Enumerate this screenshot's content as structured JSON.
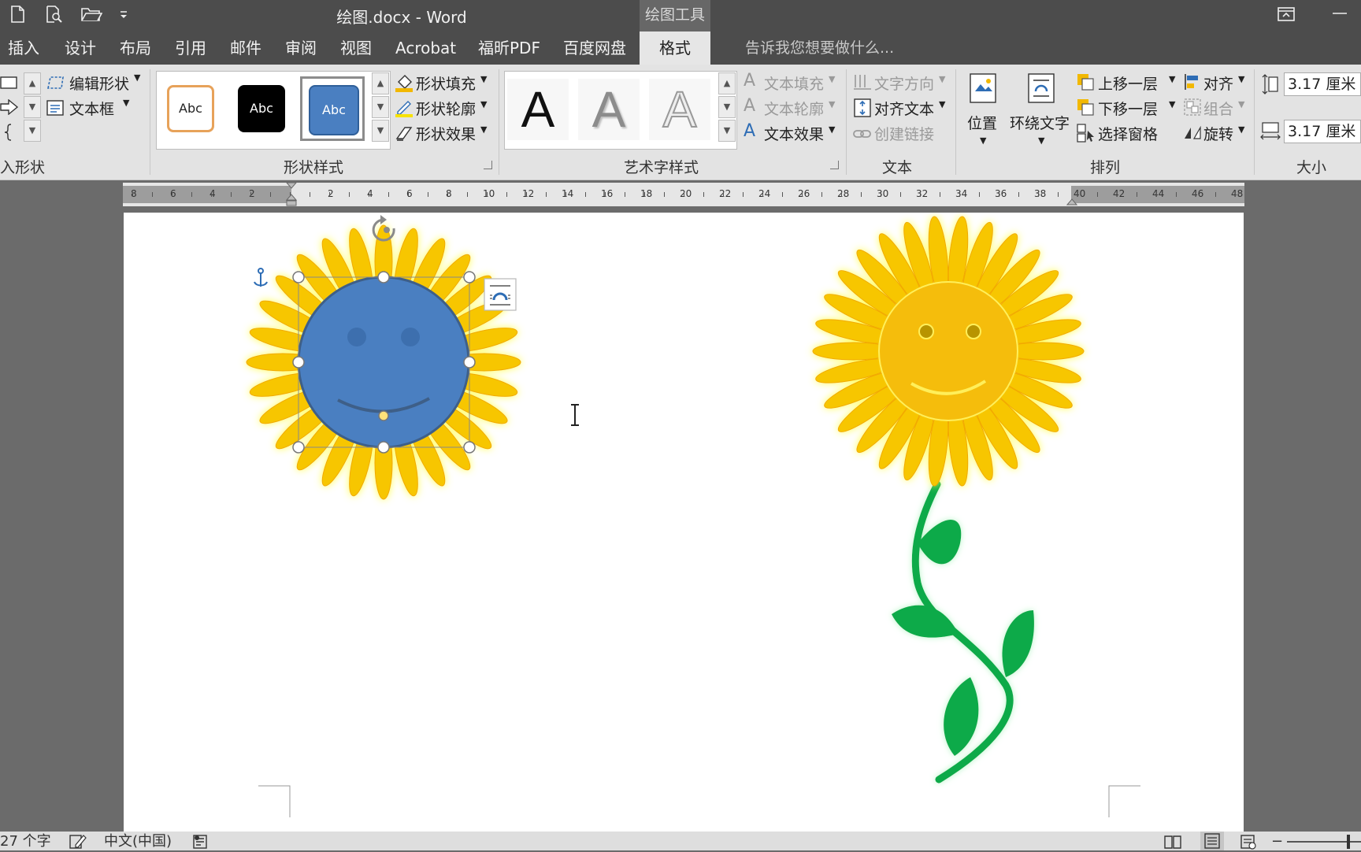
{
  "window": {
    "title": "绘图.docx - Word",
    "context_tab_group": "绘图工具"
  },
  "tabs": [
    {
      "label": "插入"
    },
    {
      "label": "设计"
    },
    {
      "label": "布局"
    },
    {
      "label": "引用"
    },
    {
      "label": "邮件"
    },
    {
      "label": "审阅"
    },
    {
      "label": "视图"
    },
    {
      "label": "Acrobat"
    },
    {
      "label": "福昕PDF"
    },
    {
      "label": "百度网盘"
    },
    {
      "label": "格式",
      "active": true
    }
  ],
  "tell_me_placeholder": "告诉我您想要做什么...",
  "ribbon": {
    "insert_shapes": {
      "edit_shape": "编辑形状",
      "text_box": "文本框",
      "group_label": "入形状"
    },
    "shape_styles": {
      "swatch_text": "Abc",
      "shape_fill": "形状填充",
      "shape_outline": "形状轮廓",
      "shape_effects": "形状效果",
      "group_label": "形状样式"
    },
    "wordart": {
      "glyph": "A",
      "text_fill": "文本填充",
      "text_outline": "文本轮廓",
      "text_effects": "文本效果",
      "group_label": "艺术字样式"
    },
    "text": {
      "text_direction": "文字方向",
      "align_text": "对齐文本",
      "create_link": "创建链接",
      "group_label": "文本"
    },
    "arrange": {
      "position": "位置",
      "wrap_text": "环绕文字",
      "bring_forward": "上移一层",
      "send_backward": "下移一层",
      "selection_pane": "选择窗格",
      "align": "对齐",
      "group": "组合",
      "rotate": "旋转",
      "group_label": "排列"
    },
    "size": {
      "height": "3.17 厘米",
      "width": "3.17 厘米",
      "group_label": "大小"
    }
  },
  "ruler": {
    "left_labels": [
      "8",
      "6",
      "4",
      "2"
    ],
    "right_labels": [
      "2",
      "4",
      "6",
      "8",
      "10",
      "12",
      "14",
      "16",
      "18",
      "20",
      "22",
      "24",
      "26",
      "28",
      "30",
      "32",
      "34",
      "36",
      "38",
      "40",
      "42",
      "44",
      "46",
      "48"
    ]
  },
  "status_bar": {
    "word_count": "27 个字",
    "language": "中文(中国)"
  },
  "colors": {
    "petal_yellow": "#f7c600",
    "glow_yellow": "#ffff55",
    "face_orange": "#f5bd0c",
    "selected_face_blue": "#4a7fc1",
    "stem_green": "#0faa4a",
    "ribbon_bg": "#e3e3e3",
    "titlebar_bg": "#4c4c4c"
  }
}
